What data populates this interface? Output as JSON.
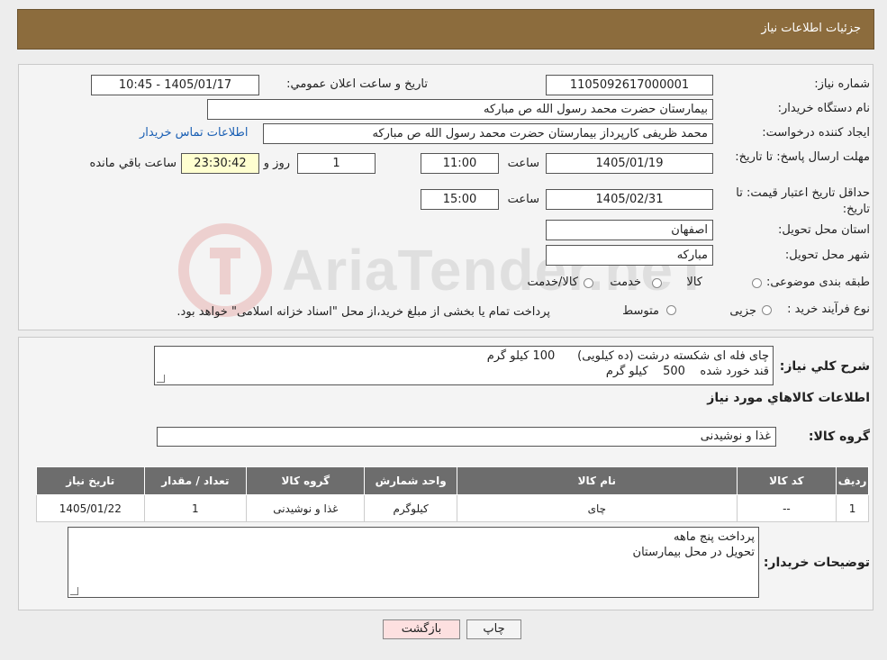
{
  "header": {
    "title": "جزئیات اطلاعات نیاز"
  },
  "fields": {
    "need_number_label": "شماره نیاز:",
    "need_number": "1105092617000001",
    "announce_label": "تاریخ و ساعت اعلان عمومي:",
    "announce_value": "1405/01/17 - 10:45",
    "buyer_org_label": "نام دستگاه خريدار:",
    "buyer_org": "بیمارستان حضرت محمد رسول الله  ص  مبارکه",
    "requester_label": "ایجاد کننده درخواست:",
    "requester": "محمد ظریفی کارپرداز بیمارستان حضرت محمد رسول الله  ص  مبارکه",
    "contact_link": "اطلاعات تماس خريدار",
    "deadline_label": "مهلت ارسال پاسخ: تا تاریخ:",
    "deadline_date": "1405/01/19",
    "time_label": "ساعت",
    "deadline_time": "11:00",
    "days_value": "1",
    "days_label": "روز و",
    "remaining_time": "23:30:42",
    "remaining_label": "ساعت باقي مانده",
    "min_validity_label": "حداقل تاریخ اعتبار قیمت: تا تاریخ:",
    "validity_date": "1405/02/31",
    "validity_time": "15:00",
    "province_label": "استان محل تحویل:",
    "province": "اصفهان",
    "city_label": "شهر محل تحویل:",
    "city": "مبارکه",
    "category_label": "طبقه بندی موضوعی:",
    "category_options": [
      "کالا",
      "خدمت",
      "کالا/خدمت"
    ],
    "process_label": "نوع فرآیند خرید :",
    "process_options": [
      "جزیی",
      "متوسط"
    ],
    "process_note": "پرداخت تمام یا بخشی از مبلغ خرید،از محل \"اسناد خزانه اسلامی\" خواهد بود."
  },
  "summary": {
    "label": "شرح کلي نياز:",
    "lines": [
      "چای فله ای شکسته درشت (ده کیلویی)      100 کیلو گرم",
      "قند خورد شده    500    کیلو گرم"
    ]
  },
  "goods": {
    "section_title": "اطلاعات کالاهاي مورد نياز",
    "group_label": "گروه کالا:",
    "group_value": "غذا و نوشیدنی",
    "columns": [
      "رديف",
      "کد کالا",
      "نام کالا",
      "واحد شمارش",
      "گروه کالا",
      "تعداد / مقدار",
      "تاریخ نیاز"
    ],
    "rows": [
      [
        "1",
        "--",
        "چای",
        "کیلوگرم",
        "غذا و نوشیدنی",
        "1",
        "1405/01/22"
      ]
    ]
  },
  "buyer_notes": {
    "label": "توضیحات خريدار:",
    "lines": [
      "پرداخت پنج ماهه",
      "تحویل در محل بیمارستان"
    ]
  },
  "buttons": {
    "print": "چاپ",
    "back": "بازگشت"
  },
  "watermark": {
    "text": "AriaTender.neT"
  },
  "colors": {
    "header": "#8c6c3d",
    "table_header": "#6d6d6d",
    "remaining_bg": "#ffffd0",
    "back_button": "#fde0e0",
    "link": "#1a5fb4"
  }
}
